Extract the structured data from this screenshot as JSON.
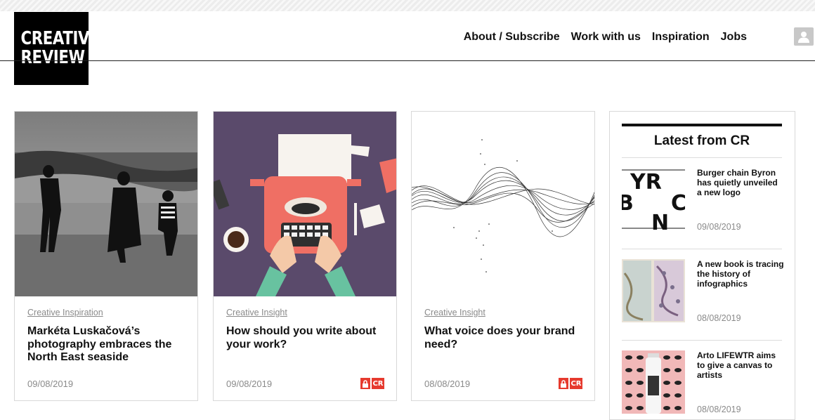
{
  "brand": {
    "line1": "CREATIVE",
    "line2": "REVIEW"
  },
  "nav": [
    {
      "label": "About / Subscribe"
    },
    {
      "label": "Work with us"
    },
    {
      "label": "Inspiration"
    },
    {
      "label": "Jobs"
    }
  ],
  "user_icon": "user-icon",
  "cards": [
    {
      "category": "Creative Inspiration",
      "title": "Markéta Luskačová’s photography embraces the North East seaside",
      "date": "09/08/2019",
      "locked": false
    },
    {
      "category": "Creative Insight",
      "title": "How should you write about your work?",
      "date": "09/08/2019",
      "locked": true,
      "badge": "CR"
    },
    {
      "category": "Creative Insight",
      "title": "What voice does your brand need?",
      "date": "08/08/2019",
      "locked": true,
      "badge": "CR"
    }
  ],
  "sidebar": {
    "heading": "Latest from CR",
    "items": [
      {
        "title": "Burger chain Byron has quietly unveiled a new logo",
        "date": "09/08/2019",
        "thumb_text": [
          "YR",
          "B",
          "C",
          "N"
        ]
      },
      {
        "title": "A new book is tracing the history of infographics",
        "date": "08/08/2019"
      },
      {
        "title": "Arto LIFEWTR aims to give a canvas to artists",
        "date": "08/08/2019"
      }
    ]
  },
  "colors": {
    "accent_red": "#e63a2e",
    "card2_bg": "#5a4a6b",
    "muted": "#8a8a8a"
  }
}
